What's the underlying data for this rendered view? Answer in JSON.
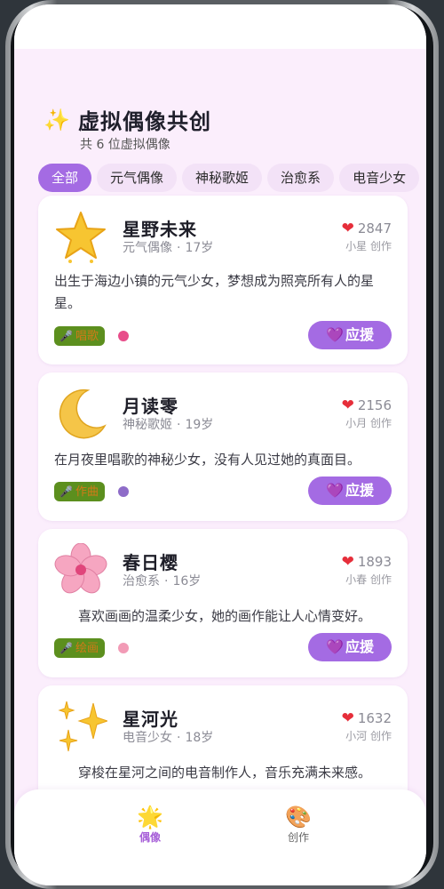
{
  "header": {
    "sparkle_icon": "✨",
    "title": "虚拟偶像共创",
    "subtitle": "共 6 位虚拟偶像"
  },
  "filters": [
    "全部",
    "元气偶像",
    "神秘歌姬",
    "治愈系",
    "电音少女"
  ],
  "active_filter": "全部",
  "idols": [
    {
      "avatar": "star",
      "name": "星野未来",
      "category": "元气偶像",
      "separator": "·",
      "age": "17岁",
      "likes": "2847",
      "creator": "小星 创作",
      "description": "出生于海边小镇的元气少女，梦想成为照亮所有人的星星。",
      "skill": "唱歌",
      "accent": "#e84d8a",
      "cheer": "应援"
    },
    {
      "avatar": "crescent-moon",
      "name": "月读零",
      "category": "神秘歌姬",
      "separator": "·",
      "age": "19岁",
      "likes": "2156",
      "creator": "小月 创作",
      "description": "在月夜里唱歌的神秘少女，没有人见过她的真面目。",
      "skill": "作曲",
      "accent": "#8e6cc8",
      "cheer": "应援"
    },
    {
      "avatar": "cherry-blossom",
      "name": "春日樱",
      "category": "治愈系",
      "separator": "·",
      "age": "16岁",
      "likes": "1893",
      "creator": "小春 创作",
      "description": "喜欢画画的温柔少女，她的画作能让人心情变好。",
      "skill": "绘画",
      "accent": "#f29bb6",
      "cheer": "应援"
    },
    {
      "avatar": "sparkles",
      "name": "星河光",
      "category": "电音少女",
      "separator": "·",
      "age": "18岁",
      "likes": "1632",
      "creator": "小河 创作",
      "description": "穿梭在星河之间的电音制作人，音乐充满未来感。",
      "skill": "",
      "accent": "#6dc3e8",
      "cheer": ""
    }
  ],
  "icons": {
    "heart": "❤",
    "mic": "🎤",
    "purple_heart": "💜"
  },
  "tabbar": [
    {
      "label": "偶像",
      "icon": "🌟",
      "active": true
    },
    {
      "label": "创作",
      "icon": "🎨",
      "active": false
    }
  ]
}
